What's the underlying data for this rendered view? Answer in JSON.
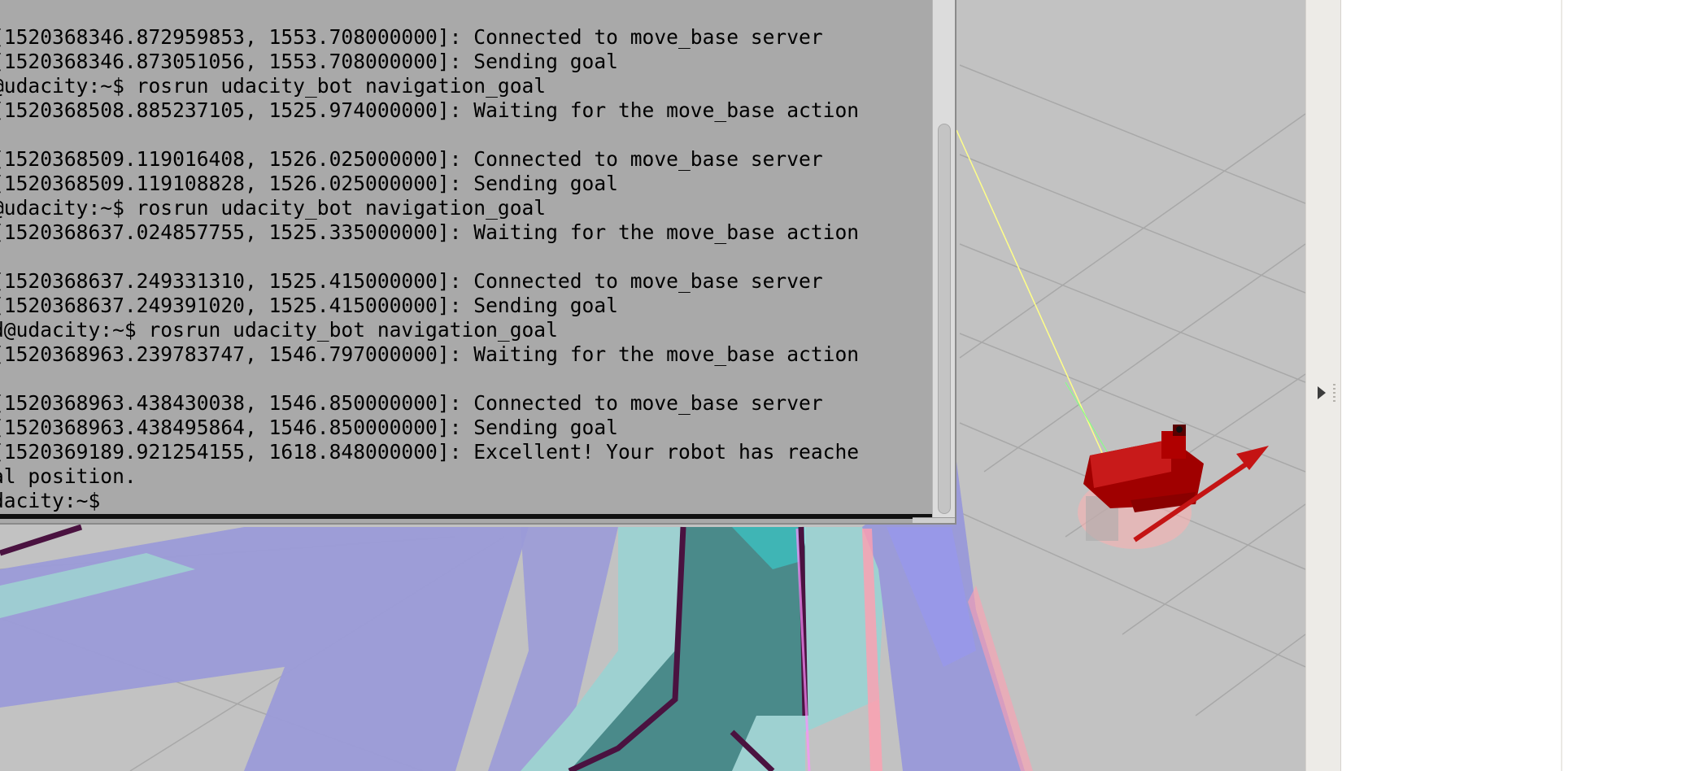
{
  "terminal": {
    "lines": [
      "[1520368346.872959853, 1553.708000000]: Connected to move_base server",
      "[1520368346.873051056, 1553.708000000]: Sending goal",
      "@udacity:~$ rosrun udacity_bot navigation_goal",
      "[1520368508.885237105, 1525.974000000]: Waiting for the move_base action",
      "",
      "[1520368509.119016408, 1526.025000000]: Connected to move_base server",
      "[1520368509.119108828, 1526.025000000]: Sending goal",
      "@udacity:~$ rosrun udacity_bot navigation_goal",
      "[1520368637.024857755, 1525.335000000]: Waiting for the move_base action",
      "",
      "[1520368637.249331310, 1525.415000000]: Connected to move_base server",
      "[1520368637.249391020, 1525.415000000]: Sending goal",
      "d@udacity:~$ rosrun udacity_bot navigation_goal",
      "[1520368963.239783747, 1546.797000000]: Waiting for the move_base action",
      "",
      "[1520368963.438430038, 1546.850000000]: Connected to move_base server",
      "[1520368963.438495864, 1546.850000000]: Sending goal",
      "[1520369189.921254155, 1618.848000000]: Excellent! Your robot has reache",
      "al position.",
      "dacity:~$"
    ]
  },
  "scene": {
    "robot_color": "#c40000",
    "goal_arrow_color": "#c41414",
    "costmap_colors": [
      "#9b9bd8",
      "#9ed1d1",
      "#4a8a8a",
      "#4a1240",
      "#ff9fb0"
    ],
    "floor_color": "#c2c2c2",
    "grid_color": "#a9a9a9"
  },
  "side_panel": {
    "expand_icon": "triangle-right-icon"
  }
}
